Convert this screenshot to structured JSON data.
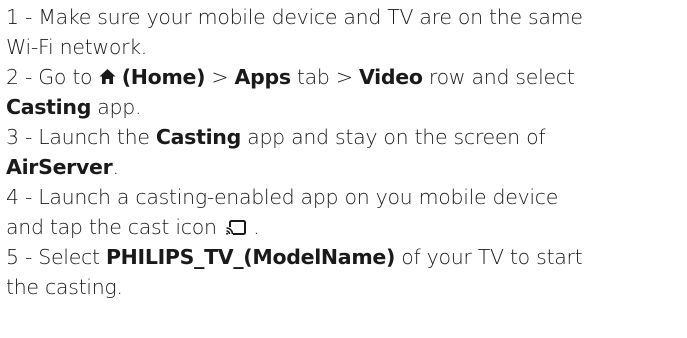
{
  "steps": [
    {
      "line1": "1 - Make sure your mobile device and TV are on the same",
      "line2": "Wi-Fi network."
    },
    {
      "prefix": "2 - Go to ",
      "home_label": "(Home)",
      "sep1": " > ",
      "apps": "Apps",
      "mid": " tab > ",
      "video": "Video",
      "tail": " row and select",
      "casting": "Casting",
      "end": " app."
    },
    {
      "prefix": "3 - Launch the ",
      "casting": "Casting",
      "mid": " app and stay on the screen of",
      "airserver": "AirServer",
      "end": "."
    },
    {
      "line1": "4 - Launch a casting-enabled app on you mobile device",
      "line2_prefix": "and tap the cast icon",
      "line2_end": " ."
    },
    {
      "prefix": "5 - Select ",
      "device": "PHILIPS_TV_(ModelName)",
      "mid": " of your TV to start",
      "line2": "the casting."
    }
  ],
  "icons": {
    "home": "home-icon",
    "cast": "cast-icon"
  }
}
